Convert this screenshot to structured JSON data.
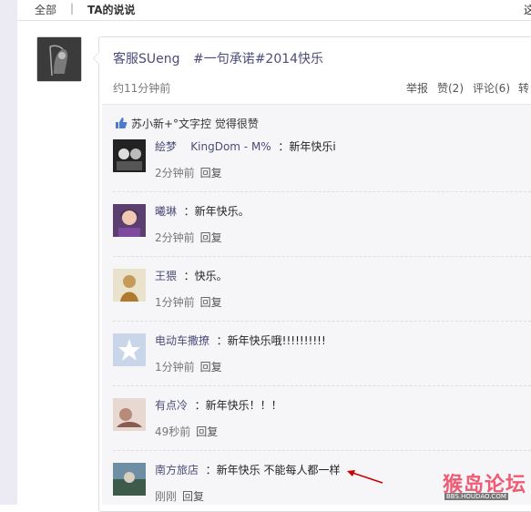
{
  "nav": {
    "all": "全部",
    "separator": "|",
    "ta": "TA的说说",
    "right_partial": "这"
  },
  "post": {
    "author": "客服SUeng",
    "topic": "#一句承诺#2014快乐",
    "time": "约11分钟前",
    "report": "举报",
    "like": "赞(2)",
    "comment": "评论(6)",
    "forward": "转"
  },
  "likes": {
    "text": "苏小新+°文字控 觉得很赞"
  },
  "comments": [
    {
      "name": "絵梦",
      "name2": "KingDom - M%",
      "text": "：新年快乐i",
      "time": "2分钟前",
      "reply": "回复"
    },
    {
      "name": "曦琳",
      "text": "：新年快乐。",
      "time": "2分钟前",
      "reply": "回复"
    },
    {
      "name": "王猥",
      "text": "：快乐。",
      "time": "1分钟前",
      "reply": "回复"
    },
    {
      "name": "电动车撒撩",
      "text": "：新年快乐哦!!!!!!!!!!",
      "time": "1分钟前",
      "reply": "回复"
    },
    {
      "name": "有点冷",
      "text": "：新年快乐！！！",
      "time": "49秒前",
      "reply": "回复"
    },
    {
      "name": "南方旅店",
      "text": "：新年快乐 不能每人都一样",
      "time": "刚刚",
      "reply": "回复"
    }
  ],
  "watermark": {
    "main": "猴岛论坛",
    "sub": "BBS.HOUDAO.COM"
  },
  "colors": {
    "link": "#4c4c7a",
    "background": "#f6f6f9",
    "watermark": "#f05a73",
    "annotation_arrow": "#cc0000"
  }
}
